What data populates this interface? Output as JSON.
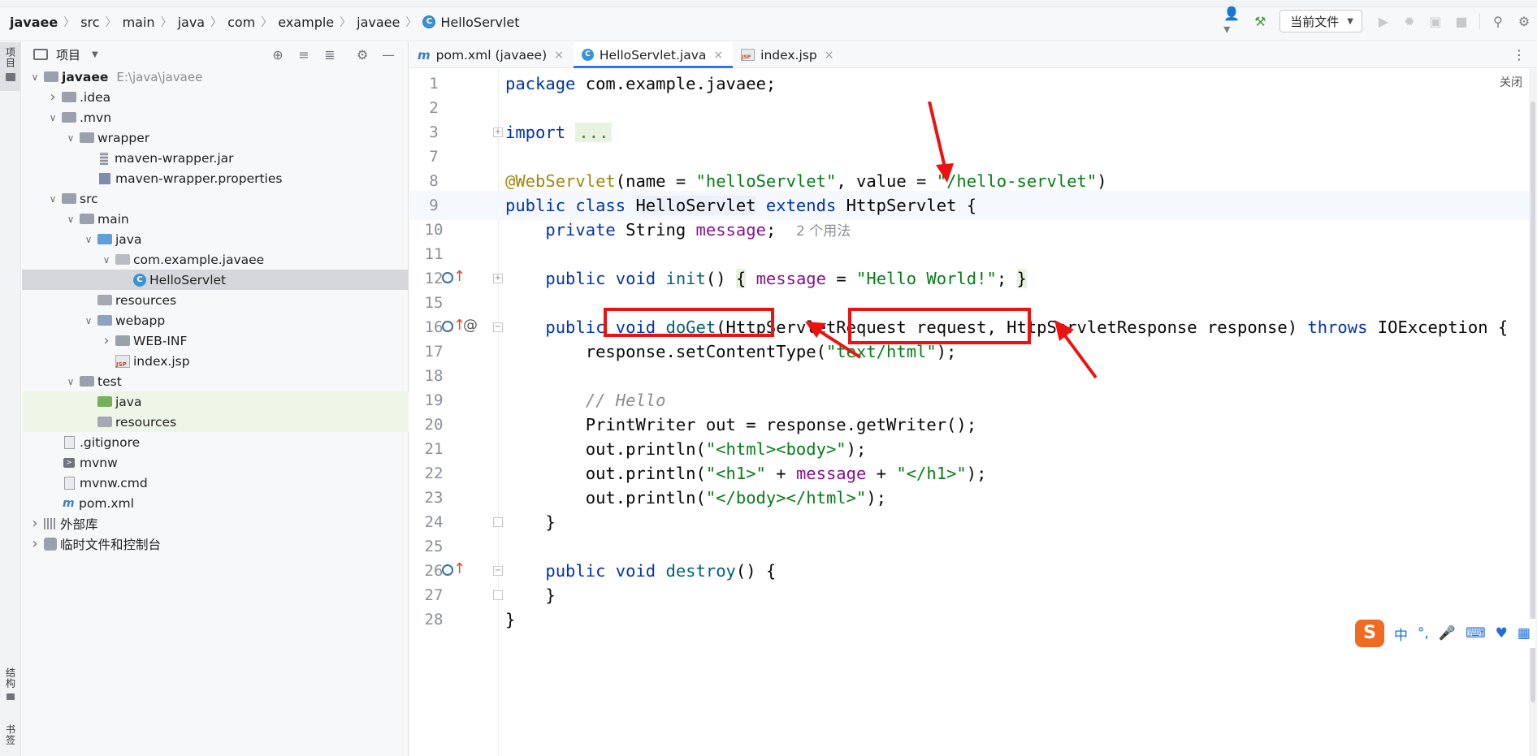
{
  "breadcrumb": [
    "javaee",
    "src",
    "main",
    "java",
    "com",
    "example",
    "javaee",
    "HelloServlet"
  ],
  "toolbar": {
    "run_config": "当前文件"
  },
  "left_strip": {
    "project": "项目",
    "structure": "结构",
    "bookmarks": "书签"
  },
  "project_panel": {
    "title": "项目",
    "tree": [
      {
        "depth": 0,
        "arrow": "v",
        "icon": "folder",
        "label": "javaee",
        "sub": "E:\\java\\javaee",
        "bold": true
      },
      {
        "depth": 1,
        "arrow": ">",
        "icon": "folder",
        "label": ".idea"
      },
      {
        "depth": 1,
        "arrow": "v",
        "icon": "folder",
        "label": ".mvn"
      },
      {
        "depth": 2,
        "arrow": "v",
        "icon": "folder",
        "label": "wrapper"
      },
      {
        "depth": 3,
        "arrow": "",
        "icon": "jar",
        "label": "maven-wrapper.jar"
      },
      {
        "depth": 3,
        "arrow": "",
        "icon": "props",
        "label": "maven-wrapper.properties"
      },
      {
        "depth": 1,
        "arrow": "v",
        "icon": "folder",
        "label": "src"
      },
      {
        "depth": 2,
        "arrow": "v",
        "icon": "folder",
        "label": "main"
      },
      {
        "depth": 3,
        "arrow": "v",
        "icon": "folder-blue",
        "label": "java"
      },
      {
        "depth": 4,
        "arrow": "v",
        "icon": "pkg",
        "label": "com.example.javaee"
      },
      {
        "depth": 5,
        "arrow": "",
        "icon": "cls",
        "label": "HelloServlet",
        "selected": true
      },
      {
        "depth": 3,
        "arrow": "",
        "icon": "folder-res",
        "label": "resources"
      },
      {
        "depth": 3,
        "arrow": "v",
        "icon": "folder-web",
        "label": "webapp"
      },
      {
        "depth": 4,
        "arrow": ">",
        "icon": "folder",
        "label": "WEB-INF"
      },
      {
        "depth": 4,
        "arrow": "",
        "icon": "jsp",
        "label": "index.jsp"
      },
      {
        "depth": 2,
        "arrow": "v",
        "icon": "folder",
        "label": "test"
      },
      {
        "depth": 3,
        "arrow": "",
        "icon": "folder-green",
        "label": "java",
        "green": true
      },
      {
        "depth": 3,
        "arrow": "",
        "icon": "folder-res",
        "label": "resources",
        "green": true
      },
      {
        "depth": 1,
        "arrow": "",
        "icon": "gitignore",
        "label": ".gitignore"
      },
      {
        "depth": 1,
        "arrow": "",
        "icon": "term",
        "label": "mvnw"
      },
      {
        "depth": 1,
        "arrow": "",
        "icon": "file",
        "label": "mvnw.cmd"
      },
      {
        "depth": 1,
        "arrow": "",
        "icon": "mvn",
        "label": "pom.xml"
      },
      {
        "depth": 0,
        "arrow": ">",
        "icon": "lib",
        "label": "外部库"
      },
      {
        "depth": 0,
        "arrow": ">",
        "icon": "scratch",
        "label": "临时文件和控制台"
      }
    ]
  },
  "tabs": [
    {
      "icon": "m",
      "label": "pom.xml (javaee)",
      "active": false
    },
    {
      "icon": "c",
      "label": "HelloServlet.java",
      "active": true
    },
    {
      "icon": "jsp",
      "label": "index.jsp",
      "active": false
    }
  ],
  "editor": {
    "close_hint": "关闭",
    "usage_hint": "2 个用法",
    "lines": [
      {
        "n": "1"
      },
      {
        "n": "2"
      },
      {
        "n": "3"
      },
      {
        "n": "7"
      },
      {
        "n": "8"
      },
      {
        "n": "9"
      },
      {
        "n": "10"
      },
      {
        "n": "11"
      },
      {
        "n": "12"
      },
      {
        "n": "15"
      },
      {
        "n": "16"
      },
      {
        "n": "17"
      },
      {
        "n": "18"
      },
      {
        "n": "19"
      },
      {
        "n": "20"
      },
      {
        "n": "21"
      },
      {
        "n": "22"
      },
      {
        "n": "23"
      },
      {
        "n": "24"
      },
      {
        "n": "25"
      },
      {
        "n": "26"
      },
      {
        "n": "27"
      },
      {
        "n": "28"
      }
    ]
  },
  "ime": {
    "logo": "S",
    "lang": "中"
  },
  "colors": {
    "annotation_red": "#ee1111",
    "accent": "#3574f0"
  }
}
